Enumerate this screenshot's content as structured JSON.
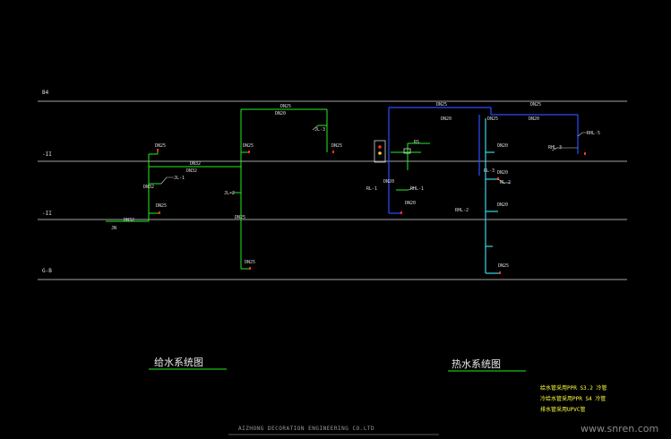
{
  "floors": [
    {
      "label": "B4"
    },
    {
      "label": "-II"
    },
    {
      "label": "-II"
    },
    {
      "label": "G-B"
    }
  ],
  "supply": {
    "title": "给水系统图",
    "labels": {
      "dn25_a": "DN25",
      "dn32_a": "DN32",
      "dn25_b": "DN25",
      "dn25_c": "DN25",
      "dn32_b": "DN32",
      "dn25_d": "DN25",
      "dn25_e": "DN25",
      "dn25_f": "DN25",
      "dn25_g": "DN25",
      "dn32_c": "DN32",
      "jl1": "JL-1",
      "jl2": "JL-2",
      "jl3": "JL-3",
      "jn": "JN",
      "small1": "DN32",
      "small2": "DN20"
    }
  },
  "hot": {
    "title": "热水系统图",
    "labels": {
      "dn25_a": "DN25",
      "dn20_a": "DN20",
      "dn25_b": "DN25",
      "dn20_b": "DN20",
      "dn20_c": "DN20",
      "dn20_d": "DN20",
      "dn20_e": "DN20",
      "dn25_c": "DN25",
      "dn20_f": "DN20",
      "dn20_g": "DN20",
      "dn25_d": "DN25",
      "rhl1": "RHL-1",
      "rhl2": "RHL-2",
      "rhl3": "RHL-3",
      "rhl5": "RHL-5",
      "rl1": "RL-1",
      "rl2": "RL-2",
      "rl3": "RL-3",
      "heater": "RS"
    }
  },
  "notes": [
    "给水管采用PPR S3.2 冷管",
    "冷给水管采用PPR S4 冷管",
    "排水管采用UPVC管"
  ],
  "footer": "AIZHONG DECORATION ENGINEERING CO.LTD",
  "watermark": "www.snren.com",
  "colors": {
    "supply": "#22ee22",
    "hot_blue": "#2b4dff",
    "hot_cyan": "#39d6e6",
    "line": "#d8d8d8"
  }
}
